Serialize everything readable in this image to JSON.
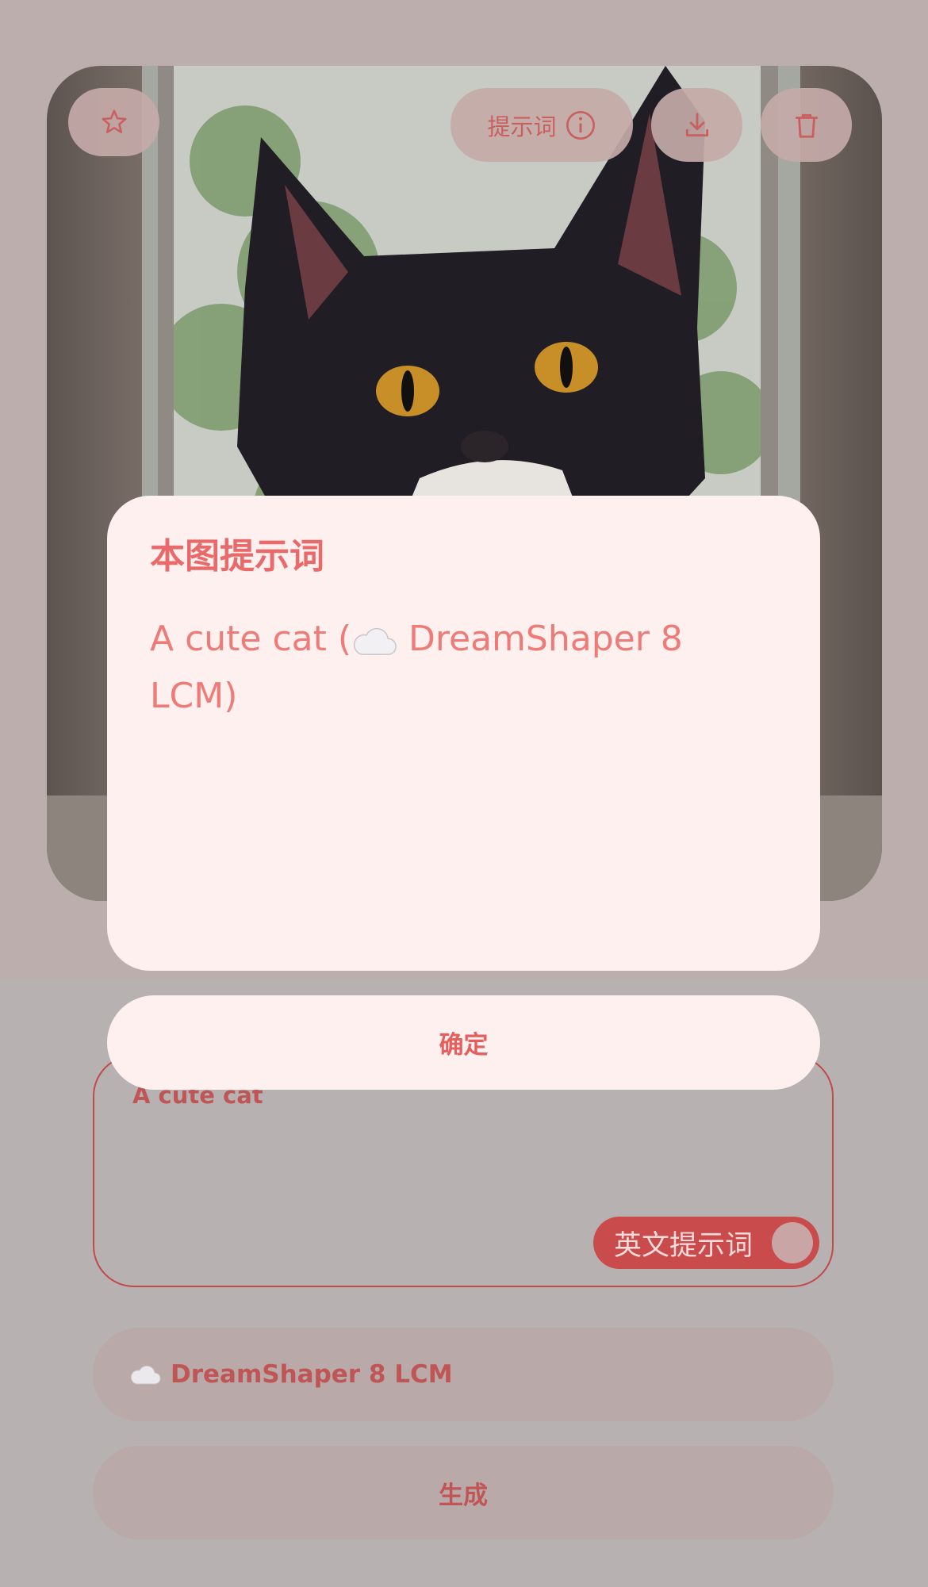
{
  "image_card": {
    "favorite_icon": "star-icon",
    "prompt_button_label": "提示词",
    "prompt_button_icon": "info-icon",
    "download_icon": "download-icon",
    "delete_icon": "trash-icon"
  },
  "prompt_input": {
    "value": "A cute cat",
    "translate_toggle_label": "英文提示词"
  },
  "model_select": {
    "icon": "cloud-icon",
    "label": "DreamShaper 8 LCM"
  },
  "generate_button": "生成",
  "dialog": {
    "title": "本图提示词",
    "body_prefix": "A cute cat (",
    "body_icon": "cloud-icon",
    "body_suffix": " DreamShaper 8 LCM)",
    "confirm_label": "确定"
  },
  "colors": {
    "accent": "#e86a6a",
    "dialog_bg": "#fdf0ef",
    "toggle_bg": "#c94b4b"
  }
}
